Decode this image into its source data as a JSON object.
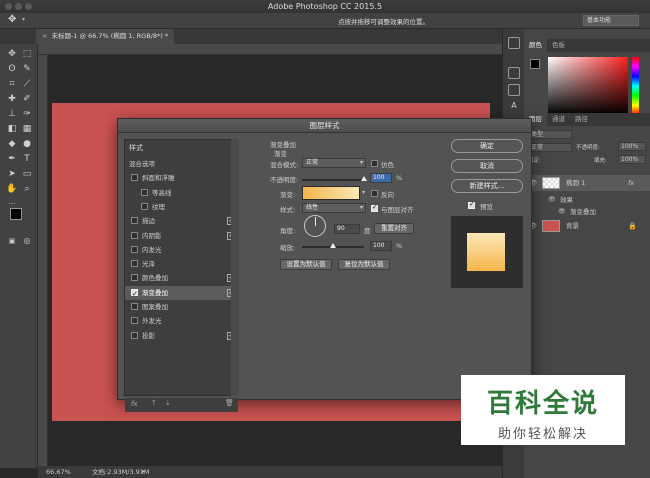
{
  "app": {
    "title": "Adobe Photoshop CC 2015.5"
  },
  "options_bar": {
    "hint": "点按并拖移可调整效果的位置。",
    "workspace": "基本功能"
  },
  "document": {
    "tab_label": "未标题-1 @ 66.7% (椭圆 1, RGB/8*) *",
    "tab_close": "×",
    "zoom": "66.67%",
    "doc_size": "文档:2.93M/3.91M"
  },
  "colors": {
    "canvas_red": "#c95252",
    "gradient_start": "#f5b54a",
    "gradient_end": "#fbe8b8"
  },
  "right_panel": {
    "color_tabs": [
      "颜色",
      "色板"
    ],
    "layer_tabs": [
      "图层",
      "通道",
      "路径"
    ],
    "kind_filter": "类型",
    "blend_mode": "正常",
    "opacity_label": "不透明度:",
    "opacity_value": "100%",
    "lock_label": "锁定:",
    "fill_label": "填充:",
    "fill_value": "100%",
    "layers": [
      {
        "name": "椭圆 1",
        "fx": "fx"
      },
      {
        "name": "效果"
      },
      {
        "name": "渐变叠加"
      },
      {
        "name": "背景"
      }
    ]
  },
  "dialog": {
    "title": "图层样式",
    "list_header": "样式",
    "list_items": [
      {
        "label": "混合选项",
        "checkbox": false,
        "plus": false,
        "checked": false
      },
      {
        "label": "斜面和浮雕",
        "checkbox": true,
        "plus": false,
        "checked": false
      },
      {
        "label": "等高线",
        "checkbox": true,
        "plus": false,
        "checked": false
      },
      {
        "label": "纹理",
        "checkbox": true,
        "plus": false,
        "checked": false
      },
      {
        "label": "描边",
        "checkbox": true,
        "plus": true,
        "checked": false
      },
      {
        "label": "内阴影",
        "checkbox": true,
        "plus": true,
        "checked": false
      },
      {
        "label": "内发光",
        "checkbox": true,
        "plus": false,
        "checked": false
      },
      {
        "label": "光泽",
        "checkbox": true,
        "plus": false,
        "checked": false
      },
      {
        "label": "颜色叠加",
        "checkbox": true,
        "plus": true,
        "checked": false
      },
      {
        "label": "渐变叠加",
        "checkbox": true,
        "plus": true,
        "checked": true
      },
      {
        "label": "图案叠加",
        "checkbox": true,
        "plus": false,
        "checked": false
      },
      {
        "label": "外发光",
        "checkbox": true,
        "plus": false,
        "checked": false
      },
      {
        "label": "投影",
        "checkbox": true,
        "plus": true,
        "checked": false
      }
    ],
    "footer_fx": "fx",
    "section_title": "渐变叠加",
    "section_sub": "渐变",
    "blend_mode_label": "混合模式:",
    "blend_mode_value": "正常",
    "dither_label": "仿色",
    "opacity_label": "不透明度:",
    "opacity_value": "100",
    "opacity_unit": "%",
    "opacity_level": 1.0,
    "gradient_label": "渐变:",
    "reverse_label": "反向",
    "style_label": "样式:",
    "style_value": "线性",
    "align_label": "与图层对齐",
    "angle_label": "角度:",
    "angle_value": "90",
    "angle_unit": "度",
    "reset_align_btn": "重置对齐",
    "scale_label": "缩放:",
    "scale_value": "100",
    "scale_unit": "%",
    "scale_level": 0.5,
    "set_default_btn": "设置为默认值",
    "reset_default_btn": "复位为默认值",
    "ok_btn": "确定",
    "cancel_btn": "取消",
    "new_style_btn": "新建样式...",
    "preview_label": "预览"
  },
  "watermark": {
    "title": "百科全说",
    "subtitle": "助你轻松解决"
  }
}
